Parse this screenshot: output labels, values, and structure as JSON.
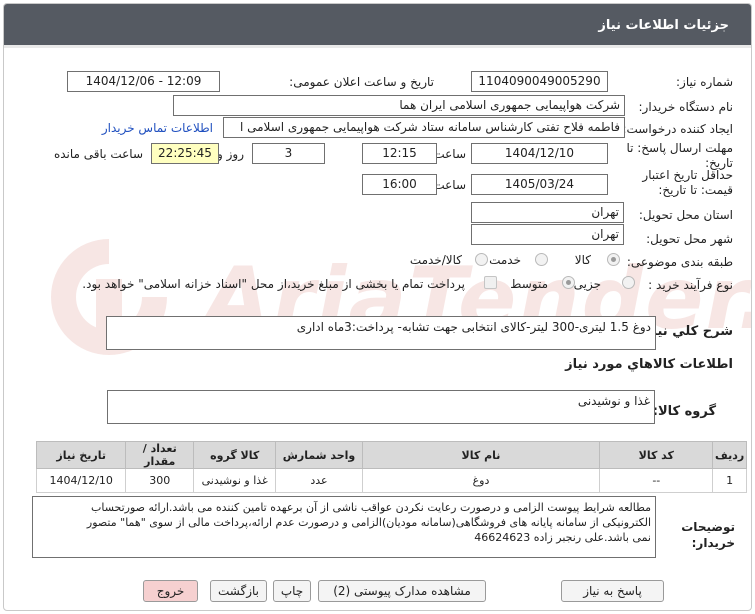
{
  "header": {
    "title": "جزئیات اطلاعات نیاز"
  },
  "fields": {
    "need_number_label": "شماره نیاز:",
    "need_number": "1104090049005290",
    "announce_label": "تاریخ و ساعت اعلان عمومی:",
    "announce_value": "1404/12/06 - 12:09",
    "buyer_label": "نام دستگاه خریدار:",
    "buyer_value": "شرکت هواپیمایی جمهوری اسلامی ایران هما",
    "creator_label": "ایجاد کننده درخواست:",
    "creator_value": "فاطمه فلاح تفتی کارشناس سامانه ستاد شرکت هواپیمایی جمهوری اسلامی ا",
    "contact_link": "اطلاعات تماس خریدار",
    "reply_deadline_label": "مهلت ارسال پاسخ: تا تاریخ:",
    "reply_date": "1404/12/10",
    "time_label": "ساعت",
    "reply_time": "12:15",
    "days_value": "3",
    "days_label": "روز و",
    "remaining_time": "22:25:45",
    "remaining_label": "ساعت باقی مانده",
    "validity_label": "حداقل تاریخ اعتبار قیمت: تا تاریخ:",
    "validity_date": "1405/03/24",
    "validity_time": "16:00",
    "province_label": "استان محل تحویل:",
    "province_value": "تهران",
    "city_label": "شهر محل تحویل:",
    "city_value": "تهران",
    "category_label": "طبقه بندی موضوعی:",
    "category_options": [
      "کالا",
      "خدمت",
      "کالا/خدمت"
    ],
    "process_label": "نوع فرآیند خرید :",
    "process_options": [
      "جزیی",
      "متوسط"
    ],
    "payment_note": "پرداخت تمام یا بخشی از مبلغ خرید،از محل \"اسناد خزانه اسلامی\" خواهد بود."
  },
  "summary": {
    "label": "شرح کلي نياز:",
    "value": "دوغ 1.5 لیتری-300 لیتر-کالای انتخابی جهت تشابه- پرداخت:3ماه اداری"
  },
  "goods_info": {
    "title": "اطلاعات کالاهاي مورد نياز",
    "group_label": "گروه کالا:",
    "group_value": "غذا و نوشیدنی"
  },
  "table": {
    "headers": [
      "ردیف",
      "کد کالا",
      "نام کالا",
      "واحد شمارش",
      "کالا گروه",
      "تعداد / مقدار",
      "تاریخ نیاز"
    ],
    "rows": [
      [
        "1",
        "--",
        "دوغ",
        "عدد",
        "غذا و نوشیدنی",
        "300",
        "1404/12/10"
      ]
    ]
  },
  "buyer_notes": {
    "label": "توضیحات خریدار:",
    "line1": "مطالعه شرایط پیوست الزامی و درصورت رعایت نکردن عواقب ناشی از آن برعهده تامین کننده می باشد.ارائه صورتحساب",
    "line2": "الکترونیکی از سامانه پایانه های فروشگاهی(سامانه مودیان)الزامی و درصورت عدم ارائه،پرداخت مالی از سوی \"هما\" متصور",
    "line3": "نمی باشد.علی رنجبر زاده 46624623"
  },
  "buttons": {
    "reply": "پاسخ به نیاز",
    "attachments": "مشاهده مدارک پیوستی (2)",
    "print": "چاپ",
    "back": "بازگشت",
    "exit": "خروج"
  },
  "watermark": {
    "text": "AriaTender.neT"
  },
  "colors": {
    "header_bg": "#555a62",
    "exit_button_bg": "#f6d0d0",
    "yellow_field": "#ffffc0",
    "link": "#1f4fbf"
  }
}
